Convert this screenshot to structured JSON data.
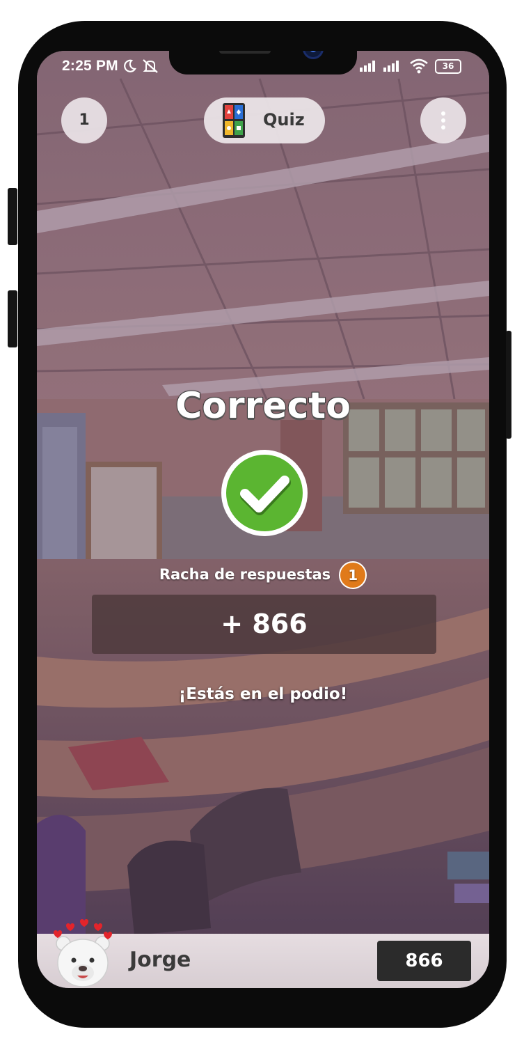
{
  "status_bar": {
    "time": "2:25 PM",
    "battery": "36"
  },
  "header": {
    "question_number": "1",
    "quiz_label": "Quiz"
  },
  "result": {
    "title": "Correcto",
    "streak_label": "Racha de respuestas",
    "streak_count": "1",
    "points": "+ 866",
    "podium_message": "¡Estás en el podio!"
  },
  "footer": {
    "player_name": "Jorge",
    "score": "866"
  },
  "colors": {
    "success": "#5bb531",
    "streak_badge": "#e07a1a",
    "points_box": "#4e3a3c",
    "score_box": "#2b2b2b"
  }
}
